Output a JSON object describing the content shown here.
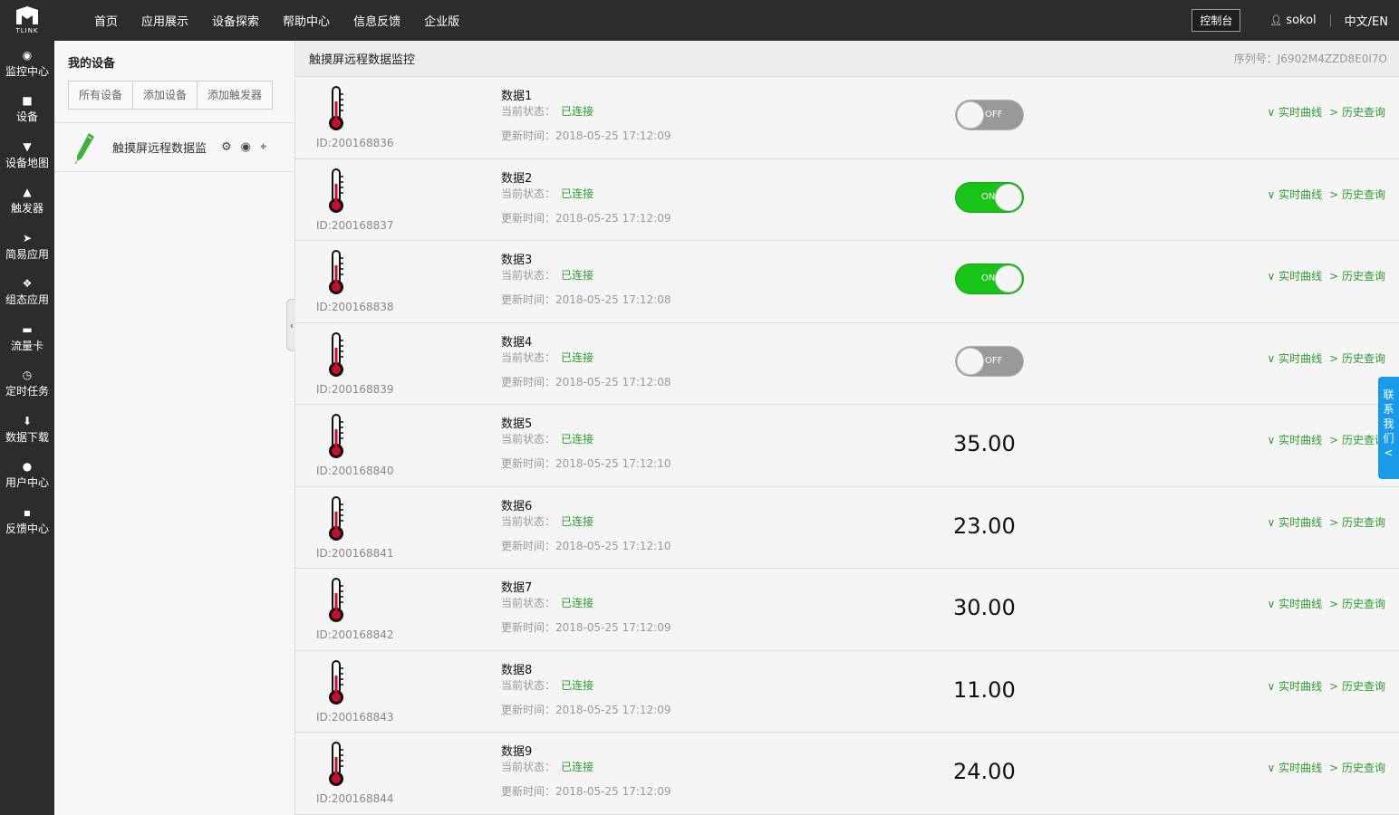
{
  "topbar": {
    "logo_text": "TLINK",
    "nav": [
      "首页",
      "应用展示",
      "设备探索",
      "帮助中心",
      "信息反馈",
      "企业版"
    ],
    "console_label": "控制台",
    "username": "sokol",
    "lang": "中文/EN"
  },
  "sidebar": {
    "items": [
      {
        "icon": "monitor-icon",
        "label": "监控中心"
      },
      {
        "icon": "device-icon",
        "label": "设备"
      },
      {
        "icon": "map-pin-icon",
        "label": "设备地图"
      },
      {
        "icon": "bell-icon",
        "label": "触发器"
      },
      {
        "icon": "send-icon",
        "label": "简易应用"
      },
      {
        "icon": "puzzle-icon",
        "label": "组态应用"
      },
      {
        "icon": "card-icon",
        "label": "流量卡"
      },
      {
        "icon": "clock-icon",
        "label": "定时任务"
      },
      {
        "icon": "download-icon",
        "label": "数据下载"
      },
      {
        "icon": "user-icon",
        "label": "用户中心"
      },
      {
        "icon": "chat-icon",
        "label": "反馈中心"
      }
    ]
  },
  "device_panel": {
    "title": "我的设备",
    "buttons": [
      "所有设备",
      "添加设备",
      "添加触发器"
    ],
    "device_name": "触摸屏远程数据监"
  },
  "main": {
    "title": "触摸屏远程数据监控",
    "serial": "序列号：J6902M4ZZD8E0I7O",
    "state_label": "当前状态：",
    "update_label": "更新时间：",
    "link_realtime": "∨ 实时曲线",
    "link_history": "> 历史查询",
    "rows": [
      {
        "id": "ID:200168836",
        "name": "数据1",
        "status": "已连接",
        "time": "2018-05-25 17:12:09",
        "kind": "switch",
        "state": "OFF"
      },
      {
        "id": "ID:200168837",
        "name": "数据2",
        "status": "已连接",
        "time": "2018-05-25 17:12:09",
        "kind": "switch",
        "state": "ON"
      },
      {
        "id": "ID:200168838",
        "name": "数据3",
        "status": "已连接",
        "time": "2018-05-25 17:12:08",
        "kind": "switch",
        "state": "ON"
      },
      {
        "id": "ID:200168839",
        "name": "数据4",
        "status": "已连接",
        "time": "2018-05-25 17:12:08",
        "kind": "switch",
        "state": "OFF"
      },
      {
        "id": "ID:200168840",
        "name": "数据5",
        "status": "已连接",
        "time": "2018-05-25 17:12:10",
        "kind": "value",
        "value": "35.00"
      },
      {
        "id": "ID:200168841",
        "name": "数据6",
        "status": "已连接",
        "time": "2018-05-25 17:12:10",
        "kind": "value",
        "value": "23.00"
      },
      {
        "id": "ID:200168842",
        "name": "数据7",
        "status": "已连接",
        "time": "2018-05-25 17:12:09",
        "kind": "value",
        "value": "30.00"
      },
      {
        "id": "ID:200168843",
        "name": "数据8",
        "status": "已连接",
        "time": "2018-05-25 17:12:09",
        "kind": "value",
        "value": "11.00"
      },
      {
        "id": "ID:200168844",
        "name": "数据9",
        "status": "已连接",
        "time": "2018-05-25 17:12:09",
        "kind": "value",
        "value": "24.00"
      }
    ]
  },
  "contact": {
    "label": [
      "联",
      "系",
      "我",
      "们"
    ],
    "arrow": "<"
  },
  "colors": {
    "accent_green": "#2e9b2e",
    "switch_on": "#17c417",
    "contact_blue": "#1a9bea",
    "bar_dark": "#2c2c2c"
  }
}
